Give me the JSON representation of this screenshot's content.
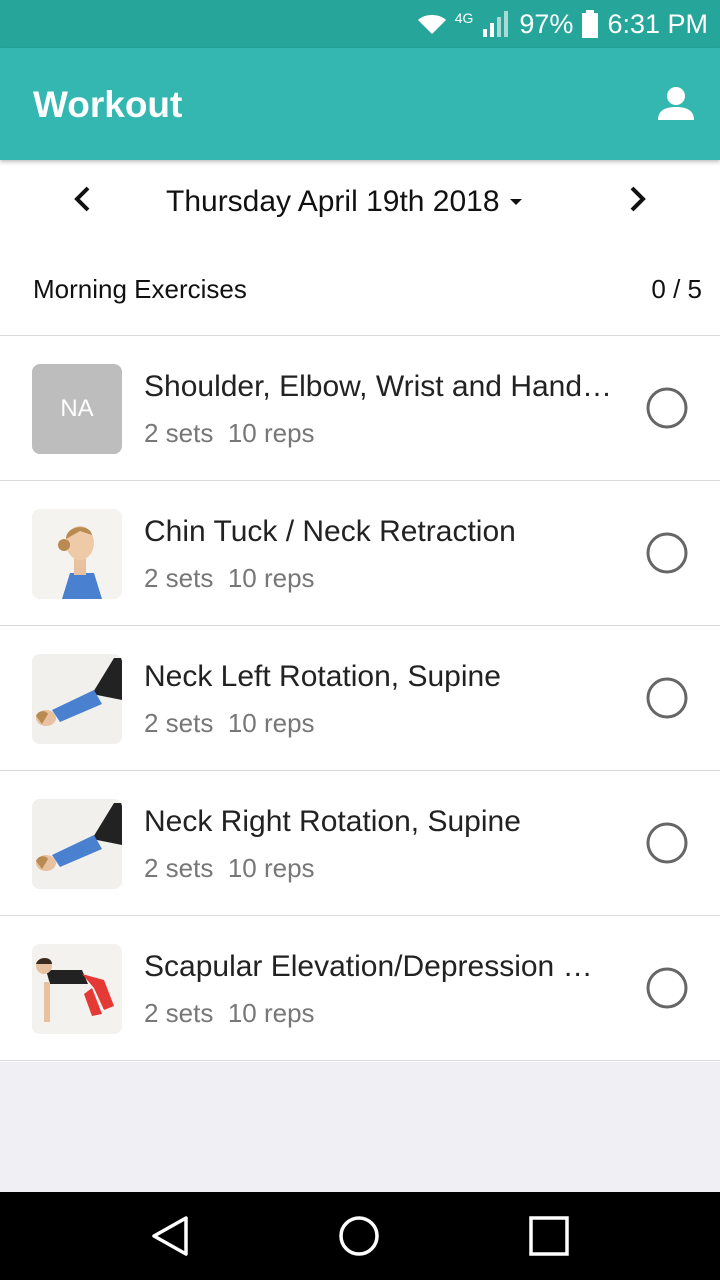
{
  "status_bar": {
    "network": "4G",
    "battery": "97%",
    "time": "6:31 PM"
  },
  "app_bar": {
    "title": "Workout",
    "profile_icon": "person-icon"
  },
  "date_nav": {
    "date_label": "Thursday April 19th 2018",
    "prev_icon": "chevron-left-icon",
    "next_icon": "chevron-right-icon",
    "dropdown_icon": "caret-down-icon"
  },
  "section": {
    "title": "Morning Exercises",
    "count": "0 / 5"
  },
  "exercises": [
    {
      "title": "Shoulder, Elbow, Wrist and Hand…",
      "detail": "2 sets  10 reps",
      "thumb_text": "NA"
    },
    {
      "title": "Chin Tuck / Neck Retraction",
      "detail": "2 sets  10 reps"
    },
    {
      "title": "Neck Left Rotation, Supine",
      "detail": "2 sets  10 reps"
    },
    {
      "title": "Neck Right Rotation, Supine",
      "detail": "2 sets  10 reps"
    },
    {
      "title": "Scapular Elevation/Depression …",
      "detail": "2 sets  10 reps"
    }
  ],
  "colors": {
    "status_bar": "#26a69a",
    "app_bar": "#34b7b0",
    "background": "#efeff4"
  },
  "nav_icons": [
    "back-icon",
    "home-icon",
    "recents-icon"
  ]
}
